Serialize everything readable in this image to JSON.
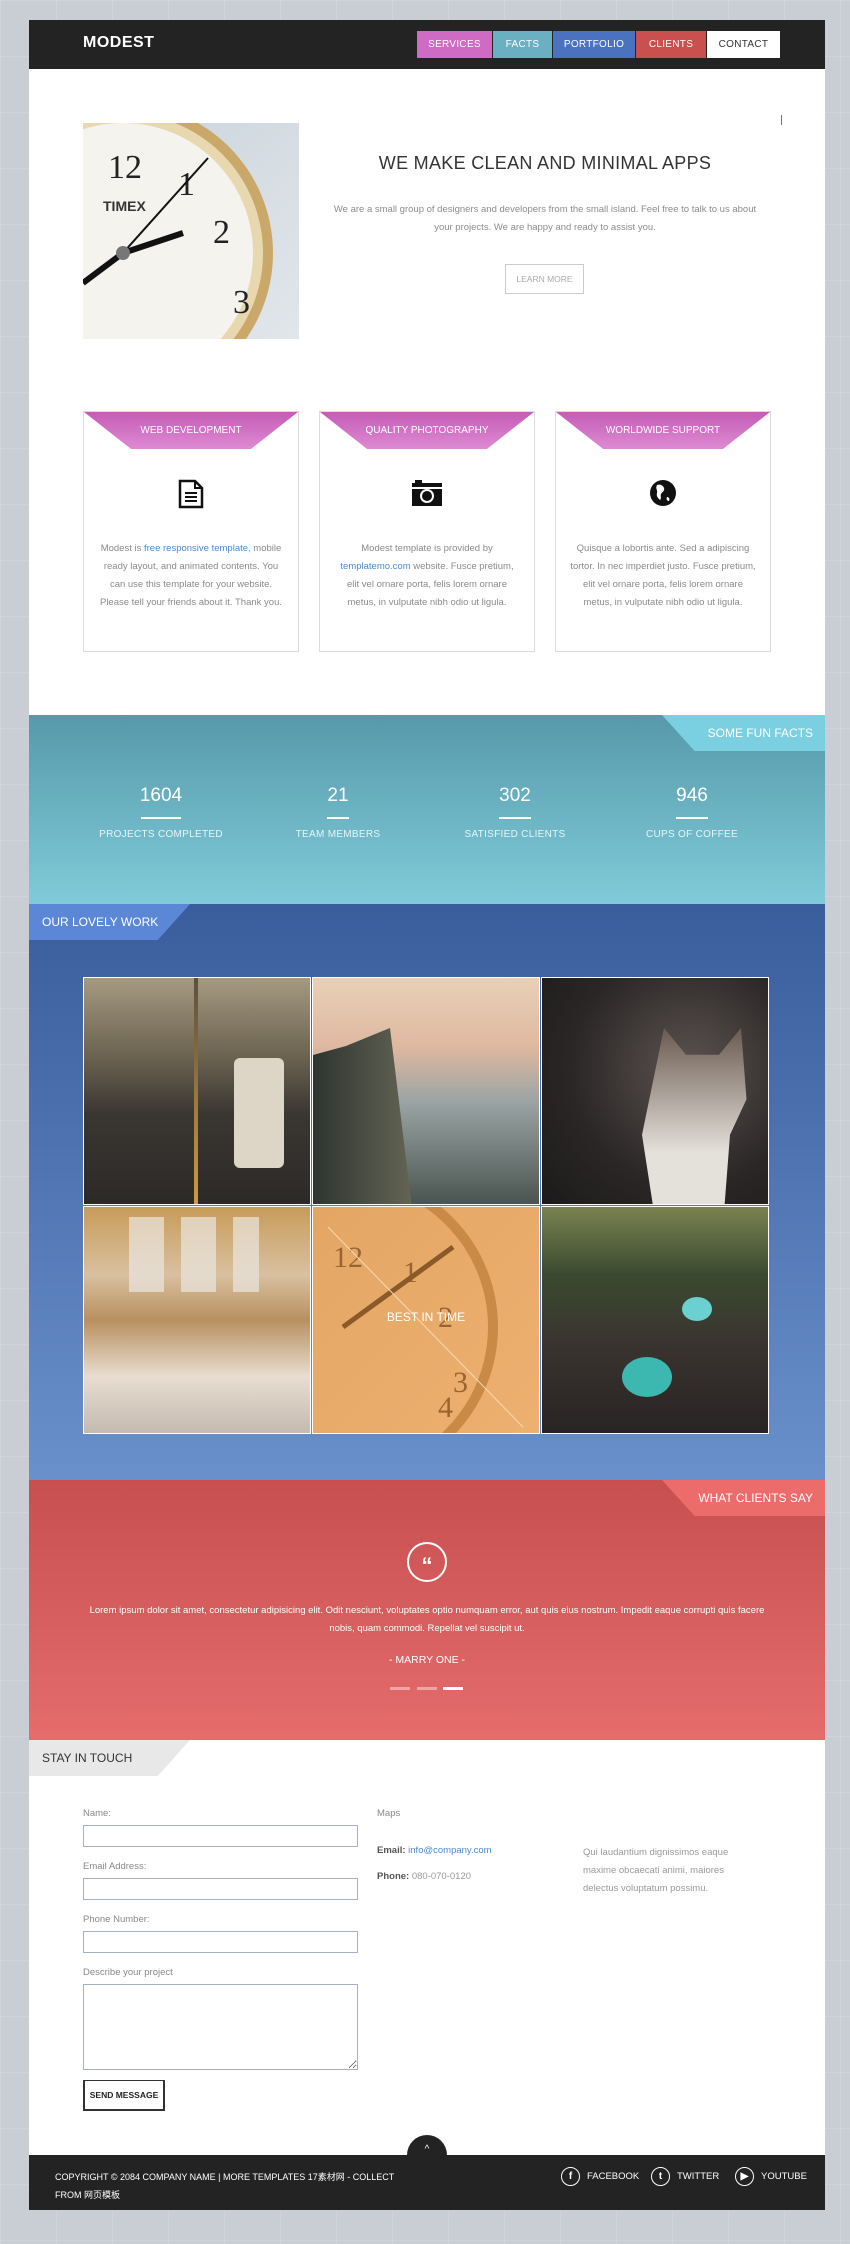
{
  "nav": {
    "logo": "MODEST",
    "items": [
      {
        "label": "SERVICES",
        "color": "#d06bc5"
      },
      {
        "label": "FACTS",
        "color": "#6ab0c2"
      },
      {
        "label": "PORTFOLIO",
        "color": "#4a72c0"
      },
      {
        "label": "CLIENTS",
        "color": "#c9504f"
      },
      {
        "label": "CONTACT",
        "color": "#ffffff"
      }
    ]
  },
  "hero": {
    "title": "WE MAKE CLEAN AND MINIMAL APPS",
    "text": "We are a small group of designers and developers from the small island. Feel free to talk to us about your projects. We are happy and ready to assist you.",
    "button": "LEARN MORE",
    "image_brand": "TIMEX"
  },
  "services": [
    {
      "title": "WEB DEVELOPMENT",
      "icon": "document-icon",
      "pre": "Modest is ",
      "link": "free responsive template",
      "post": ", mobile ready layout, and animated contents. You can use this template for your website. Please tell your friends about it. Thank you."
    },
    {
      "title": "QUALITY PHOTOGRAPHY",
      "icon": "camera-icon",
      "pre": "Modest template is provided by ",
      "link": "templatemo.com",
      "post": " website. Fusce pretium, elit vel ornare porta, felis lorem ornare metus, in vulputate nibh odio ut ligula."
    },
    {
      "title": "WORLDWIDE SUPPORT",
      "icon": "globe-icon",
      "pre": "Quisque a lobortis ante. Sed a adipiscing tortor. In nec imperdiet justo. Fusce pretium, elit vel ornare porta, felis lorem ornare metus, in vulputate nibh odio ut ligula.",
      "link": "",
      "post": ""
    }
  ],
  "facts": {
    "badge": "SOME FUN FACTS",
    "items": [
      {
        "value": "1604",
        "label": "PROJECTS COMPLETED"
      },
      {
        "value": "21",
        "label": "TEAM MEMBERS"
      },
      {
        "value": "302",
        "label": "SATISFIED CLIENTS"
      },
      {
        "value": "946",
        "label": "CUPS OF COFFEE"
      }
    ]
  },
  "work": {
    "badge": "OUR LOVELY WORK",
    "hover_caption": "BEST IN TIME"
  },
  "clients": {
    "badge": "WHAT CLIENTS SAY",
    "quote": "Lorem ipsum dolor sit amet, consectetur adipisicing elit. Odit nesciunt, voluptates optio numquam error, aut quis eius nostrum. Impedit eaque corrupti quis facere nobis, quam commodi. Repellat vel suscipit ut.",
    "author": "-  MARRY ONE  -",
    "active_slide": 3
  },
  "contact": {
    "badge": "STAY IN TOUCH",
    "labels": {
      "name": "Name:",
      "email": "Email Address:",
      "phone": "Phone Number:",
      "project": "Describe your project"
    },
    "values": {
      "name": "",
      "email": "",
      "phone": "",
      "project": ""
    },
    "send": "SEND MESSAGE",
    "maps": "Maps",
    "email_label": "Email:",
    "email": "info@company.com",
    "phone_label": "Phone:",
    "phone": "080-070-0120",
    "side_text": "Qui laudantium dignissimos eaque maxime obcaecati animi, maiores delectus voluptatum possimu."
  },
  "footer": {
    "copyright": "COPYRIGHT © 2084 COMPANY NAME | MORE TEMPLATES 17素材网 - COLLECT FROM 网页模板",
    "social": [
      {
        "label": "FACEBOOK",
        "icon": "facebook-icon"
      },
      {
        "label": "TWITTER",
        "icon": "twitter-icon"
      },
      {
        "label": "YOUTUBE",
        "icon": "youtube-icon"
      }
    ]
  }
}
